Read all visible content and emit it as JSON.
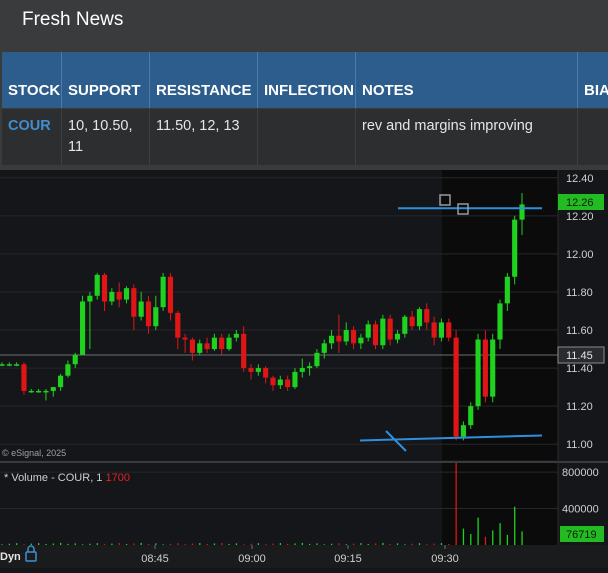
{
  "news": {
    "title": "Fresh News",
    "columns": [
      "STOCK",
      "SUPPORT",
      "RESISTANCE",
      "INFLECTION",
      "NOTES",
      "BIA"
    ],
    "rows": [
      {
        "stock": "COUR",
        "support": "10, 10.50, 11",
        "resistance": "11.50, 12, 13",
        "inflection": "",
        "notes": "rev and margins improving",
        "bias": ""
      }
    ]
  },
  "chart": {
    "price_axis_labels": [
      "12.40",
      "12.20",
      "12.00",
      "11.80",
      "11.60",
      "11.40",
      "11.20",
      "11.00"
    ],
    "current_price_label": "12.26",
    "hover_price_label": "11.45",
    "copyright": "© eSignal, 2025",
    "volume_title_prefix": "* Volume - COUR, 1 ",
    "volume_title_value": "1700",
    "volume_axis_labels": [
      "800000",
      "400000"
    ],
    "volume_value_label": "76719",
    "time_labels": [
      "08:45",
      "09:00",
      "09:15",
      "09:30"
    ],
    "dyn_label": "Dyn",
    "colors": {
      "up": "#1fd21f",
      "down": "#e01616",
      "annotation": "#2f8fdc",
      "badge": "#22bb22",
      "accent_volume": "#e02424"
    }
  },
  "chart_data": {
    "type": "candlestick",
    "symbol": "COUR",
    "interval": "1 minute",
    "price_ylim": [
      10.98,
      12.42
    ],
    "x_ticks": [
      "08:45",
      "09:00",
      "09:15",
      "09:30"
    ],
    "last_price": 12.26,
    "hover_price": 11.45,
    "candles": [
      [
        11.42,
        11.43,
        11.41,
        11.42
      ],
      [
        11.42,
        11.43,
        11.41,
        11.42
      ],
      [
        11.42,
        11.43,
        11.41,
        11.42
      ],
      [
        11.42,
        11.43,
        11.26,
        11.28
      ],
      [
        11.28,
        11.29,
        11.27,
        11.28
      ],
      [
        11.28,
        11.29,
        11.27,
        11.28
      ],
      [
        11.28,
        11.29,
        11.23,
        11.28
      ],
      [
        11.28,
        11.3,
        11.25,
        11.3
      ],
      [
        11.3,
        11.37,
        11.28,
        11.36
      ],
      [
        11.36,
        11.44,
        11.35,
        11.42
      ],
      [
        11.42,
        11.48,
        11.4,
        11.47
      ],
      [
        11.47,
        11.78,
        11.47,
        11.75
      ],
      [
        11.75,
        11.8,
        11.5,
        11.78
      ],
      [
        11.78,
        11.9,
        11.76,
        11.89
      ],
      [
        11.89,
        11.9,
        11.7,
        11.75
      ],
      [
        11.75,
        11.82,
        11.73,
        11.8
      ],
      [
        11.8,
        11.85,
        11.72,
        11.76
      ],
      [
        11.76,
        11.83,
        11.74,
        11.82
      ],
      [
        11.82,
        11.84,
        11.6,
        11.67
      ],
      [
        11.67,
        11.8,
        11.65,
        11.75
      ],
      [
        11.75,
        11.78,
        11.58,
        11.62
      ],
      [
        11.62,
        11.78,
        11.6,
        11.72
      ],
      [
        11.72,
        11.9,
        11.7,
        11.88
      ],
      [
        11.88,
        11.9,
        11.65,
        11.69
      ],
      [
        11.69,
        11.7,
        11.5,
        11.56
      ],
      [
        11.56,
        11.58,
        11.48,
        11.55
      ],
      [
        11.55,
        11.56,
        11.44,
        11.48
      ],
      [
        11.48,
        11.55,
        11.47,
        11.53
      ],
      [
        11.53,
        11.56,
        11.48,
        11.5
      ],
      [
        11.5,
        11.58,
        11.49,
        11.56
      ],
      [
        11.56,
        11.58,
        11.47,
        11.5
      ],
      [
        11.5,
        11.58,
        11.49,
        11.56
      ],
      [
        11.56,
        11.6,
        11.54,
        11.58
      ],
      [
        11.58,
        11.62,
        11.38,
        11.4
      ],
      [
        11.4,
        11.42,
        11.34,
        11.38
      ],
      [
        11.38,
        11.42,
        11.36,
        11.4
      ],
      [
        11.4,
        11.41,
        11.32,
        11.35
      ],
      [
        11.35,
        11.36,
        11.28,
        11.31
      ],
      [
        11.31,
        11.36,
        11.29,
        11.34
      ],
      [
        11.34,
        11.36,
        11.28,
        11.3
      ],
      [
        11.3,
        11.4,
        11.29,
        11.38
      ],
      [
        11.38,
        11.45,
        11.35,
        11.4
      ],
      [
        11.4,
        11.43,
        11.36,
        11.41
      ],
      [
        11.41,
        11.5,
        11.4,
        11.48
      ],
      [
        11.48,
        11.55,
        11.45,
        11.53
      ],
      [
        11.53,
        11.6,
        11.5,
        11.57
      ],
      [
        11.57,
        11.68,
        11.48,
        11.54
      ],
      [
        11.54,
        11.64,
        11.52,
        11.6
      ],
      [
        11.6,
        11.62,
        11.5,
        11.53
      ],
      [
        11.53,
        11.58,
        11.5,
        11.56
      ],
      [
        11.56,
        11.65,
        11.54,
        11.63
      ],
      [
        11.63,
        11.65,
        11.5,
        11.52
      ],
      [
        11.52,
        11.68,
        11.5,
        11.66
      ],
      [
        11.66,
        11.68,
        11.52,
        11.55
      ],
      [
        11.55,
        11.6,
        11.53,
        11.58
      ],
      [
        11.58,
        11.68,
        11.56,
        11.67
      ],
      [
        11.67,
        11.7,
        11.6,
        11.62
      ],
      [
        11.62,
        11.72,
        11.6,
        11.71
      ],
      [
        11.71,
        11.74,
        11.6,
        11.64
      ],
      [
        11.64,
        11.67,
        11.52,
        11.56
      ],
      [
        11.56,
        11.66,
        11.54,
        11.64
      ],
      [
        11.64,
        11.66,
        11.54,
        11.56
      ],
      [
        11.56,
        11.6,
        11.02,
        11.04
      ],
      [
        11.04,
        11.12,
        11.02,
        11.1
      ],
      [
        11.1,
        11.22,
        11.08,
        11.2
      ],
      [
        11.2,
        11.58,
        11.18,
        11.55
      ],
      [
        11.55,
        11.6,
        11.22,
        11.25
      ],
      [
        11.25,
        11.58,
        11.22,
        11.55
      ],
      [
        11.55,
        11.76,
        11.5,
        11.74
      ],
      [
        11.74,
        11.9,
        11.7,
        11.88
      ],
      [
        11.88,
        12.2,
        11.84,
        12.18
      ],
      [
        12.18,
        12.32,
        12.1,
        12.26
      ]
    ],
    "volume_ylim": [
      0,
      900000
    ],
    "volume_ticks": [
      800000,
      400000
    ],
    "last_volume": 76719,
    "annotations": [
      {
        "type": "horizontal_line",
        "price": 12.24,
        "label": "resistance"
      },
      {
        "type": "horizontal_line",
        "price": 11.03,
        "label": "support"
      }
    ]
  }
}
